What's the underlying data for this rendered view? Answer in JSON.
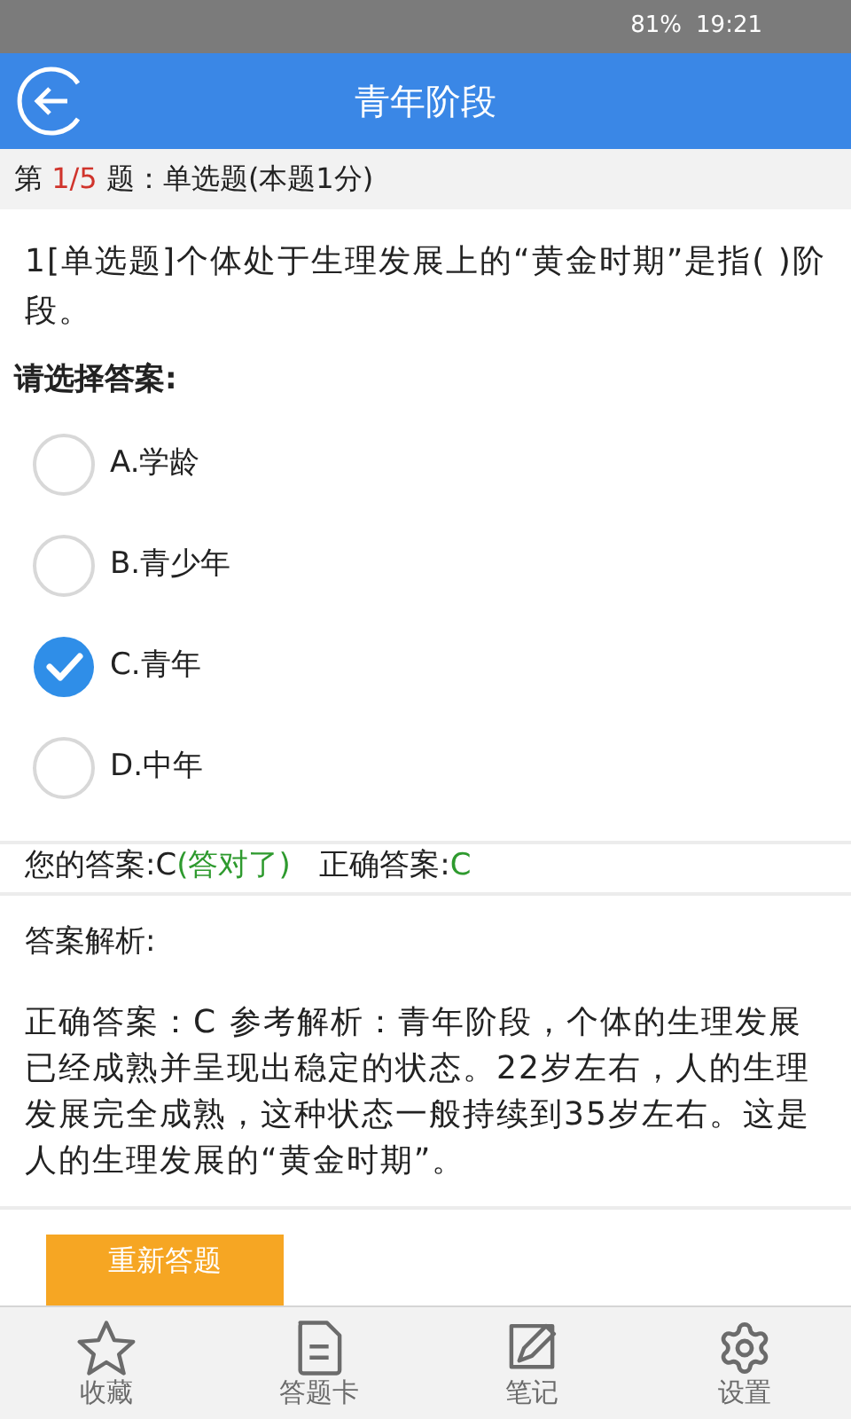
{
  "status_bar": {
    "battery": "81%",
    "time": "19:21"
  },
  "header": {
    "title": "青年阶段"
  },
  "question_info": {
    "prefix": "第",
    "index": "1/5",
    "suffix": "题：单选题(本题1分)"
  },
  "question": "1[单选题]个体处于生理发展上的“黄金时期”是指( )阶段。",
  "prompt": "请选择答案:",
  "options": [
    {
      "label": "A.学龄",
      "selected": false
    },
    {
      "label": "B.青少年",
      "selected": false
    },
    {
      "label": "C.青年",
      "selected": true
    },
    {
      "label": "D.中年",
      "selected": false
    }
  ],
  "result": {
    "your_label": "您的答案:",
    "your_answer": "C",
    "verdict": "(答对了)",
    "correct_label": "正确答案:",
    "correct_answer": "C"
  },
  "analysis": {
    "title": "答案解析:",
    "text": "正确答案：C 参考解析：青年阶段，个体的生理发展已经成熟并呈现出稳定的状态。22岁左右，人的生理发展完全成熟，这种状态一般持续到35岁左右。这是人的生理发展的“黄金时期”。"
  },
  "retry_button": "重新答题",
  "bottom_nav": [
    {
      "label": "收藏",
      "kind": "star"
    },
    {
      "label": "答题卡",
      "kind": "sheet"
    },
    {
      "label": "笔记",
      "kind": "note"
    },
    {
      "label": "设置",
      "kind": "gear"
    }
  ]
}
